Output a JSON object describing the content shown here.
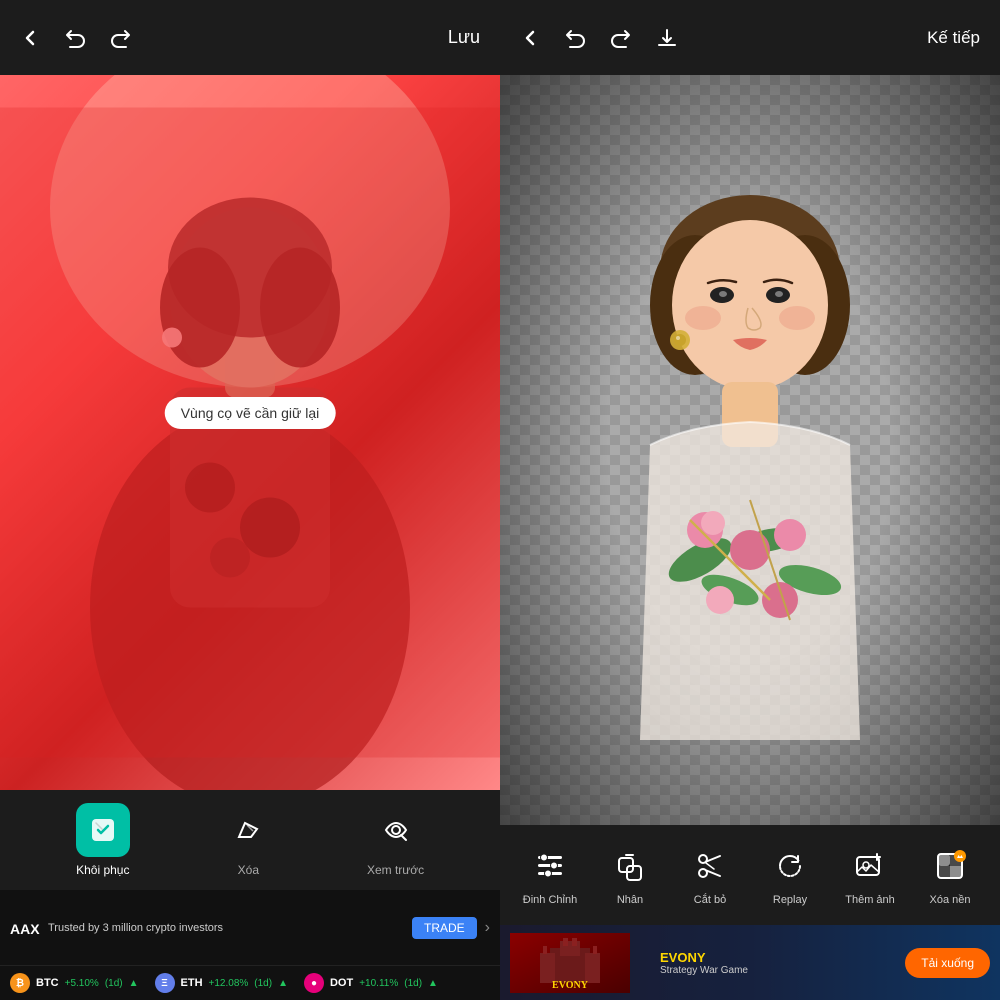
{
  "left": {
    "header": {
      "back_label": "‹",
      "undo_label": "↩",
      "redo_label": "↪",
      "save_label": "Lưu"
    },
    "tooltip": "Vùng cọ vẽ cần giữ lại",
    "tools": [
      {
        "id": "restore",
        "label": "Khôi phục",
        "active": true
      },
      {
        "id": "erase",
        "label": "Xóa",
        "active": false
      },
      {
        "id": "preview",
        "label": "Xem trước",
        "active": false
      }
    ],
    "ad": {
      "logo": "AAX",
      "tagline": "Trusted by 3 million crypto investors",
      "trade_label": "TRADE"
    },
    "crypto": [
      {
        "symbol": "BTC",
        "change": "+5.10%",
        "period": "(1d)"
      },
      {
        "symbol": "ETH",
        "change": "+12.08%",
        "period": "(1d)"
      },
      {
        "symbol": "DOT",
        "change": "+10.11%",
        "period": "(1d)"
      }
    ]
  },
  "right": {
    "header": {
      "back_label": "‹",
      "undo_label": "↩",
      "redo_label": "↪",
      "save_label": "⬇",
      "next_label": "Kế tiếp"
    },
    "tools": [
      {
        "id": "adjust",
        "label": "Đinh Chỉnh"
      },
      {
        "id": "stamp",
        "label": "Nhân"
      },
      {
        "id": "catbo",
        "label": "Cắt bỏ"
      },
      {
        "id": "replay",
        "label": "Replay"
      },
      {
        "id": "add_photo",
        "label": "Thêm ảnh"
      },
      {
        "id": "remove_bg",
        "label": "Xóa nền"
      }
    ],
    "ad": {
      "game_name": "EVONY",
      "download_label": "Tải xuống"
    }
  }
}
